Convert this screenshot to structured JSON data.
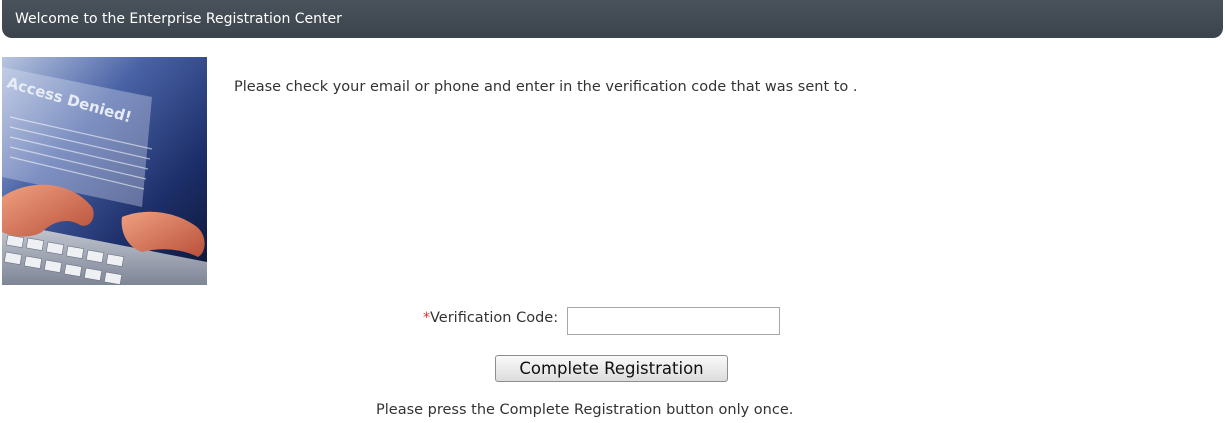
{
  "header": {
    "title": "Welcome to the Enterprise Registration Center"
  },
  "hero": {
    "image_text": "Access Denied!"
  },
  "main": {
    "instruction": "Please check your email or phone and enter in the verification code that was sent to ."
  },
  "form": {
    "required_mark": "*",
    "verification_label": "Verification Code:",
    "verification_value": "",
    "submit_label": "Complete Registration",
    "note": "Please press the Complete Registration button only once."
  },
  "colors": {
    "header_bg": "#3f474f",
    "required": "#e03030"
  }
}
